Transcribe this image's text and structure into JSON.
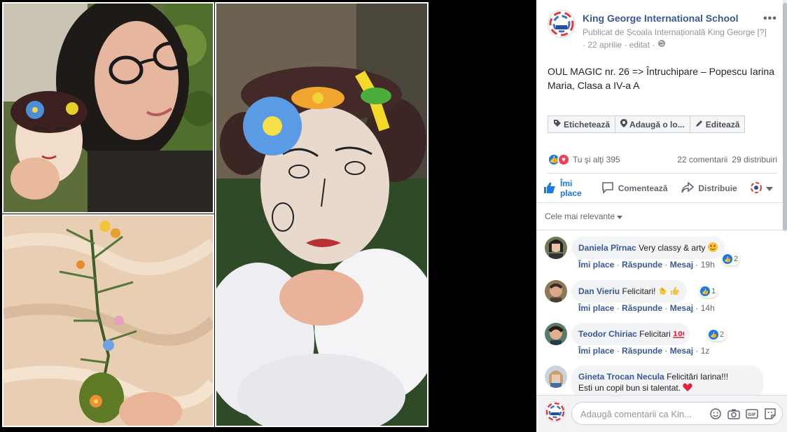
{
  "post": {
    "page_name": "King George International School",
    "published_by": "Publicat de Școala Internațională King George",
    "help_mark": "[?]",
    "date": "· 22 aprilie · editat ·",
    "text": "OUL MAGIC nr. 26 => Întruchipare – Popescu Iarina Maria, Clasa a IV-a A"
  },
  "actions": {
    "tag": "Etichetează",
    "location": "Adaugă o lo...",
    "edit": "Editează"
  },
  "reactions": {
    "summary": "Tu şi alţi 395",
    "comments": "22 comentarii",
    "shares": "29 distribuiri"
  },
  "buttons": {
    "like_line1": "Îmi",
    "like_line2": "place",
    "comment": "Comentează",
    "share": "Distribuie"
  },
  "sort_label": "Cele mai relevante",
  "comments": [
    {
      "name": "Daniela Pîrnac",
      "text": "Very classy & arty",
      "like": "Îmi place",
      "reply": "Răspunde",
      "msg": "Mesaj",
      "time": "19h",
      "count": "2"
    },
    {
      "name": "Dan Vieriu",
      "text": "Felicitari!",
      "like": "Îmi place",
      "reply": "Răspunde",
      "msg": "Mesaj",
      "time": "14h",
      "count": "1"
    },
    {
      "name": "Teodor Chiriac",
      "text": "Felicitari",
      "like": "Îmi place",
      "reply": "Răspunde",
      "msg": "Mesaj",
      "time": "1z",
      "count": "2"
    },
    {
      "name": "Gineta Trocan Necula",
      "text": "Felicitări Iarina!!!",
      "text2": "Esti un copil bun si talentat."
    }
  ],
  "composer": {
    "placeholder": "Adaugă comentarii ca Kin..."
  },
  "colors": {
    "link": "#385898",
    "like_blue": "#1877f2",
    "love_red": "#f33e58"
  }
}
